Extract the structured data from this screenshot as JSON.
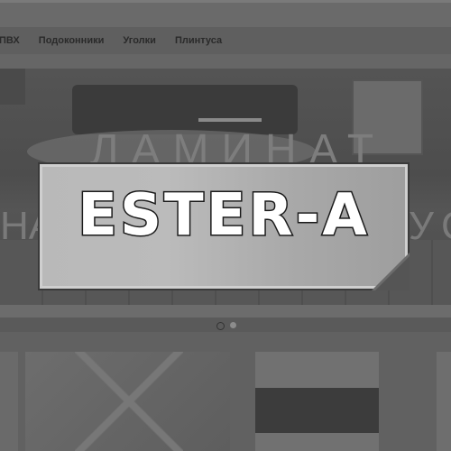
{
  "nav": {
    "items": [
      {
        "label": "ПВХ"
      },
      {
        "label": "Подоконники"
      },
      {
        "label": "Уголки"
      },
      {
        "label": "Плинтуса"
      }
    ]
  },
  "hero": {
    "title": "ЛАМИНАТ",
    "subtitle_left": "НА",
    "subtitle_right": "УС"
  },
  "badge": {
    "text": "ESTER-A"
  },
  "colors": {
    "overlay": "#5d5d5d",
    "badge_bg": "#b9b9b9",
    "badge_text": "#ffffff",
    "badge_outline": "#1a1a1a"
  }
}
